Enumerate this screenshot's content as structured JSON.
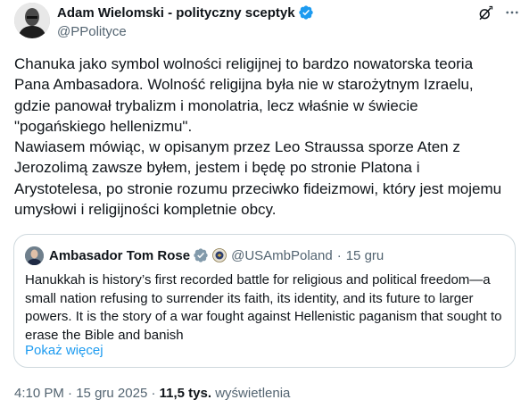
{
  "author": {
    "name": "Adam Wielomski - polityczny sceptyk",
    "handle": "@PPolityce"
  },
  "tweet": {
    "text": "Chanuka jako symbol wolności religijnej to bardzo nowatorska teoria Pana Ambasadora. Wolność religijna była nie w starożytnym Izraelu, gdzie panował trybalizm i monolatria, lecz właśnie w świecie \"pogańskiego hellenizmu\".\nNawiasem mówiąc, w opisanym przez Leo Straussa sporze Aten z Jerozolimą zawsze byłem, jestem i będę po stronie Platona i Arystotelesa, po stronie rozumu przeciwko fideizmowi, który jest mojemu umysłowi i religijności kompletnie obcy."
  },
  "quote": {
    "name": "Ambasador Tom Rose",
    "handle": "@USAmbPoland",
    "separator": "·",
    "date": "15 gru",
    "text": "Hanukkah is history’s first recorded battle for religious and political freedom—a small nation refusing to surrender its faith, its identity, and its future to larger powers. It is the story of a war fought against Hellenistic paganism that sought to erase the Bible and banish",
    "show_more": "Pokaż więcej"
  },
  "meta": {
    "time": "4:10 PM",
    "separator1": "·",
    "date": "15 gru 2025",
    "separator2": "·",
    "views_count": "11,5 tys.",
    "views_label": "wyświetlenia"
  },
  "icons": {
    "verified": "verified-badge-icon",
    "grok": "grok-icon",
    "more": "more-options-icon",
    "gov_seal": "government-seal-icon"
  },
  "colors": {
    "verified_blue": "#1d9bf0",
    "link_blue": "#1d9bf0",
    "secondary_text": "#536471",
    "border": "#cfd9de"
  }
}
